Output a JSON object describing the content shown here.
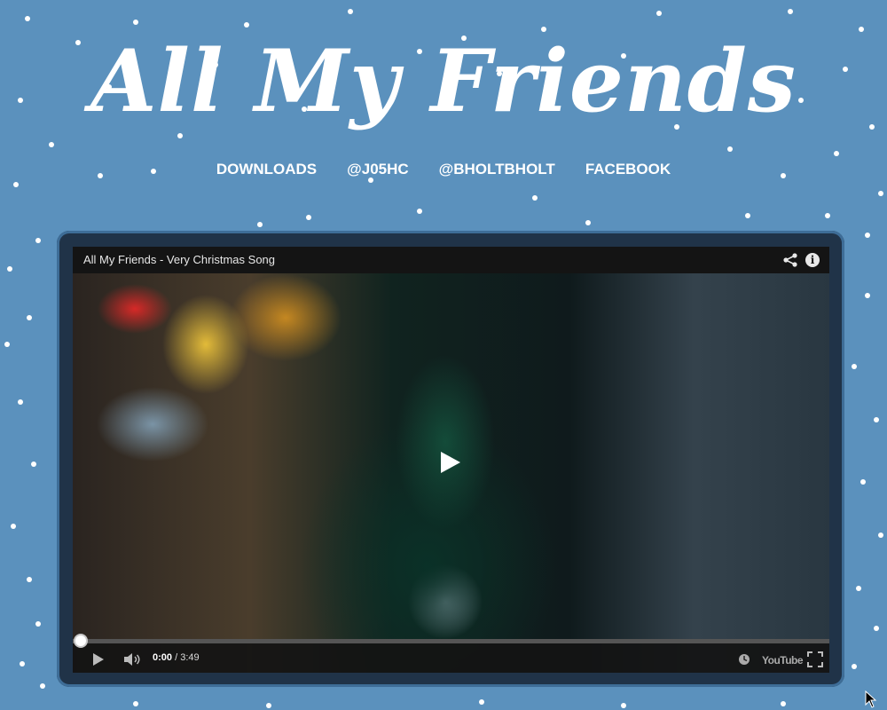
{
  "site": {
    "title": "All My Friends",
    "background_color": "#5b91bd"
  },
  "nav": {
    "items": [
      {
        "label": "DOWNLOADS"
      },
      {
        "label": "@J05HC"
      },
      {
        "label": "@BHOLTBHOLT"
      },
      {
        "label": "FACEBOOK"
      }
    ]
  },
  "player": {
    "title": "All My Friends - Very Christmas Song",
    "current_time": "0:00",
    "separator": " / ",
    "duration": "3:49",
    "progress_fraction": 0,
    "logo_text": "YouTube",
    "icons": {
      "share": "share-icon",
      "info": "info-icon",
      "big_play": "play-icon",
      "play": "play-icon",
      "volume": "volume-icon",
      "watch_later": "clock-icon",
      "fullscreen": "fullscreen-icon",
      "info_glyph": "i"
    }
  }
}
